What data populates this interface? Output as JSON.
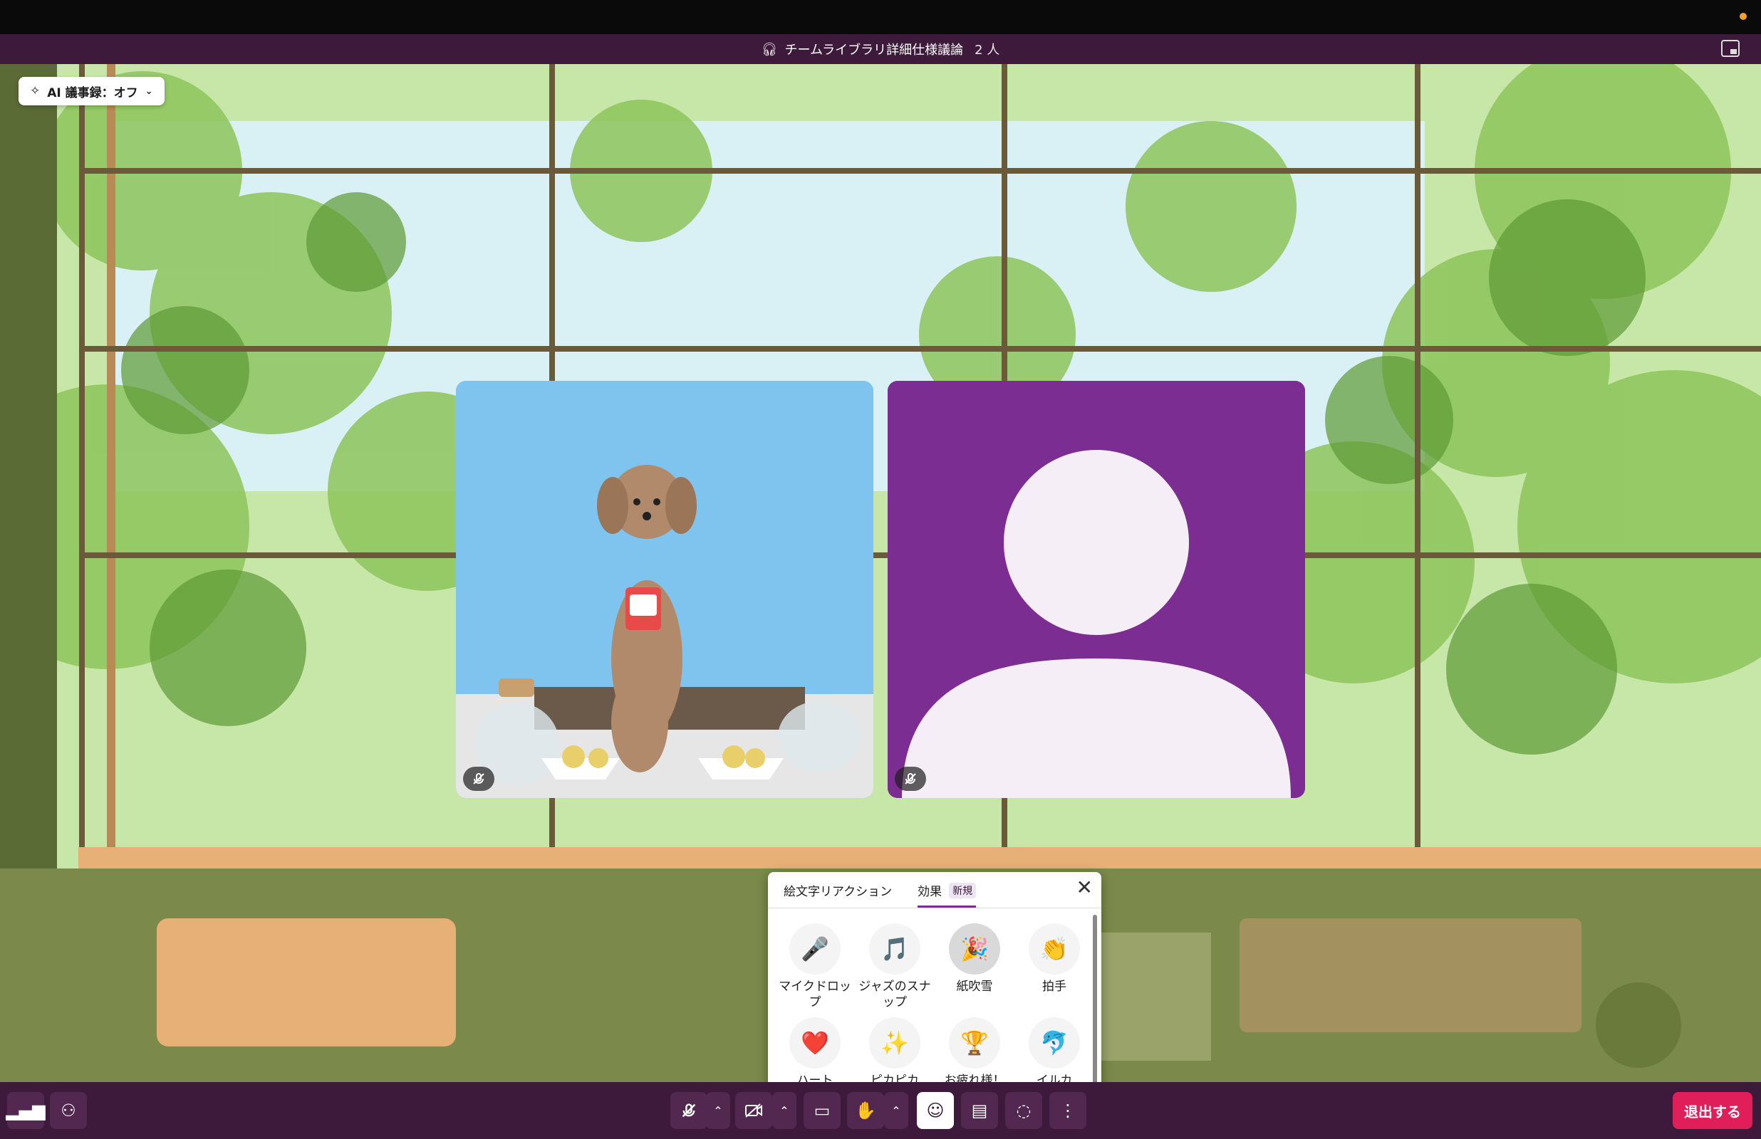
{
  "huddle": {
    "title": "チームライブラリ詳細仕様議論",
    "participant_count": "2 人"
  },
  "ai_notes": {
    "label": "AI 議事録：オフ"
  },
  "reactions": {
    "tab_emoji": "絵文字リアクション",
    "tab_effects": "効果",
    "new_badge": "新規",
    "items": [
      {
        "label": "マイクドロップ",
        "icon": "🎤"
      },
      {
        "label": "ジャズのスナップ",
        "icon": "🎵"
      },
      {
        "label": "紙吹雪",
        "icon": "🎉"
      },
      {
        "label": "拍手",
        "icon": "👏"
      },
      {
        "label": "ハート",
        "icon": "❤️"
      },
      {
        "label": "ピカピカ",
        "icon": "✨"
      },
      {
        "label": "お疲れ様！",
        "icon": "🏆"
      },
      {
        "label": "イルカ",
        "icon": "🐬"
      },
      {
        "label": "",
        "icon": "🚀"
      },
      {
        "label": "",
        "icon": "⏰"
      },
      {
        "label": "",
        "icon": "🦒"
      }
    ]
  },
  "leave_button": "退出する",
  "colors": {
    "aubergine": "#3d1a3b",
    "avatar_bg": "#7b2d91",
    "leave": "#e01e5a"
  }
}
